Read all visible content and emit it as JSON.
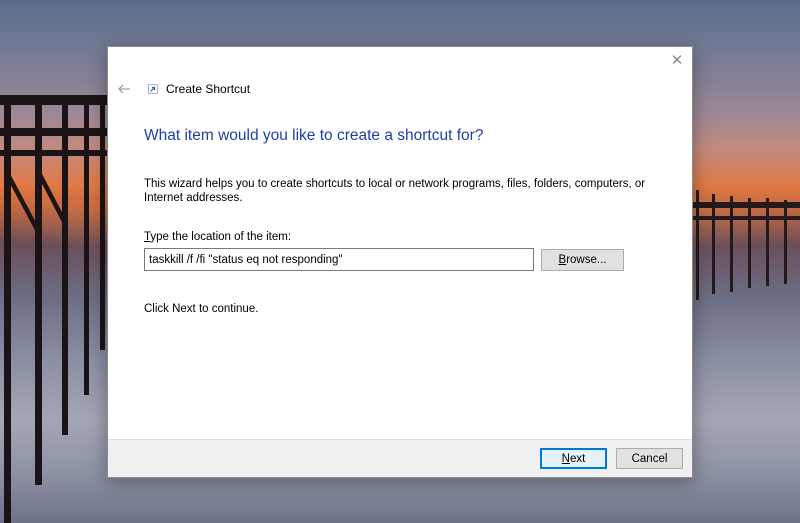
{
  "wizard": {
    "title": "Create Shortcut",
    "close_glyph": "✕",
    "back_icon": "back-arrow-icon",
    "title_icon": "shortcut-icon"
  },
  "page": {
    "heading": "What item would you like to create a shortcut for?",
    "description": "This wizard helps you to create shortcuts to local or network programs, files, folders, computers, or Internet addresses.",
    "field_label_accel": "T",
    "field_label_rest": "ype the location of the item:",
    "location_value": "taskkill /f /fi \"status eq not responding\"",
    "browse_accel": "B",
    "browse_rest": "rowse...",
    "continue_text": "Click Next to continue."
  },
  "footer": {
    "next_accel": "N",
    "next_rest": "ext",
    "cancel_label": "Cancel"
  },
  "colors": {
    "heading": "#1f3fa8",
    "accent": "#0078d7"
  }
}
